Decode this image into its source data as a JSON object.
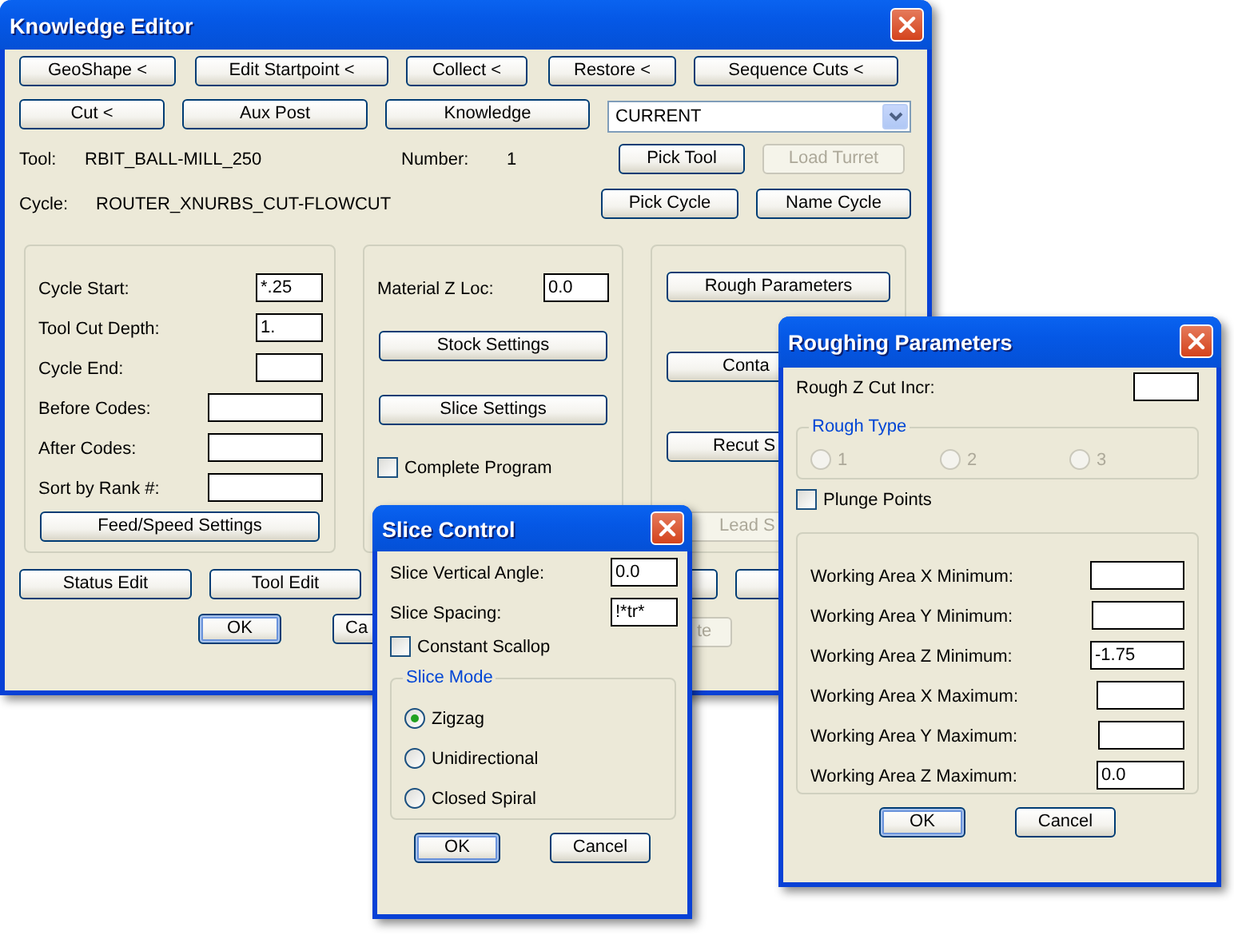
{
  "windows": [
    {
      "kind": "main",
      "title": "Knowledge Editor",
      "controls": [
        {
          "kind": "button",
          "label": "GeoShape <",
          "disabled": false,
          "default": false
        },
        {
          "kind": "button",
          "label": "Edit Startpoint <",
          "disabled": false,
          "default": false
        },
        {
          "kind": "button",
          "label": "Collect <",
          "disabled": false,
          "default": false
        },
        {
          "kind": "button",
          "label": "Restore <",
          "disabled": false,
          "default": false
        },
        {
          "kind": "button",
          "label": "Sequence Cuts <",
          "disabled": false,
          "default": false
        },
        {
          "kind": "button",
          "label": "Cut <",
          "disabled": false,
          "default": false
        },
        {
          "kind": "button",
          "label": "Aux Post",
          "disabled": false,
          "default": false
        },
        {
          "kind": "button",
          "label": "Knowledge",
          "disabled": false,
          "default": false
        },
        {
          "kind": "combo",
          "value": "CURRENT"
        },
        {
          "kind": "label",
          "text": "Tool:"
        },
        {
          "kind": "label",
          "text": "RBIT_BALL-MILL_250"
        },
        {
          "kind": "label",
          "text": "Number:"
        },
        {
          "kind": "label",
          "text": "1"
        },
        {
          "kind": "button",
          "label": "Pick Tool",
          "disabled": false,
          "default": false
        },
        {
          "kind": "button",
          "label": "Load Turret",
          "disabled": true,
          "default": false
        },
        {
          "kind": "label",
          "text": "Cycle:"
        },
        {
          "kind": "label",
          "text": "ROUTER_XNURBS_CUT-FLOWCUT"
        },
        {
          "kind": "button",
          "label": "Pick Cycle",
          "disabled": false,
          "default": false
        },
        {
          "kind": "button",
          "label": "Name Cycle",
          "disabled": false,
          "default": false
        },
        {
          "kind": "group"
        },
        {
          "kind": "label",
          "text": "Cycle Start:"
        },
        {
          "kind": "field",
          "value": "*.25"
        },
        {
          "kind": "label",
          "text": "Tool Cut Depth:"
        },
        {
          "kind": "field",
          "value": "1."
        },
        {
          "kind": "label",
          "text": "Cycle End:"
        },
        {
          "kind": "field"
        },
        {
          "kind": "label",
          "text": "Before Codes:"
        },
        {
          "kind": "field"
        },
        {
          "kind": "label",
          "text": "After Codes:"
        },
        {
          "kind": "field"
        },
        {
          "kind": "label",
          "text": "Sort by Rank #:"
        },
        {
          "kind": "field"
        },
        {
          "kind": "button",
          "label": "Feed/Speed Settings",
          "disabled": false,
          "default": false
        },
        {
          "kind": "group"
        },
        {
          "kind": "label",
          "text": "Material Z Loc:"
        },
        {
          "kind": "field",
          "value": "0.0"
        },
        {
          "kind": "button",
          "label": "Stock Settings",
          "disabled": false,
          "default": false
        },
        {
          "kind": "button",
          "label": "Slice Settings",
          "disabled": false,
          "default": false
        },
        {
          "kind": "checkbox",
          "label": "Complete Program",
          "checked": false
        },
        {
          "kind": "group"
        },
        {
          "kind": "button",
          "label": "Rough Parameters",
          "disabled": false,
          "default": false
        },
        {
          "kind": "button",
          "label": "Conta",
          "disabled": false,
          "default": false
        },
        {
          "kind": "button",
          "label": "Recut S",
          "disabled": false,
          "default": false
        },
        {
          "kind": "button",
          "label": "Lead S",
          "disabled": true,
          "default": false
        },
        {
          "kind": "button",
          "label": "Status Edit",
          "disabled": false,
          "default": false
        },
        {
          "kind": "button",
          "label": "Tool Edit",
          "disabled": false,
          "default": false
        },
        {
          "kind": "button",
          "disabled": false,
          "default": false
        },
        {
          "kind": "button",
          "disabled": false,
          "default": false
        },
        {
          "kind": "button",
          "label": "OK",
          "disabled": false,
          "default": true
        },
        {
          "kind": "button",
          "label": "Ca",
          "disabled": false,
          "default": false
        },
        {
          "kind": "button",
          "label": "te",
          "disabled": true,
          "default": false
        }
      ]
    },
    {
      "kind": "dialog",
      "title": "Slice Control",
      "controls": [
        {
          "kind": "label",
          "text": "Slice Vertical Angle:"
        },
        {
          "kind": "field",
          "value": "0.0"
        },
        {
          "kind": "label",
          "text": "Slice Spacing:"
        },
        {
          "kind": "field",
          "value": "!*tr*"
        },
        {
          "kind": "checkbox",
          "label": "Constant Scallop",
          "checked": false
        },
        {
          "kind": "group",
          "caption": "Slice Mode"
        },
        {
          "kind": "radio",
          "label": "Zigzag",
          "selected": true,
          "disabled": false
        },
        {
          "kind": "radio",
          "label": "Unidirectional",
          "selected": false,
          "disabled": false
        },
        {
          "kind": "radio",
          "label": "Closed Spiral",
          "selected": false,
          "disabled": false
        },
        {
          "kind": "button",
          "label": "OK",
          "disabled": false,
          "default": true
        },
        {
          "kind": "button",
          "label": "Cancel",
          "disabled": false,
          "default": false
        }
      ]
    },
    {
      "kind": "dialog",
      "title": "Roughing Parameters",
      "controls": [
        {
          "kind": "label",
          "text": "Rough Z Cut Incr:"
        },
        {
          "kind": "field"
        },
        {
          "kind": "group",
          "caption": "Rough Type"
        },
        {
          "kind": "radio",
          "label": "1",
          "selected": false,
          "disabled": true
        },
        {
          "kind": "radio",
          "label": "2",
          "selected": false,
          "disabled": true
        },
        {
          "kind": "radio",
          "label": "3",
          "selected": false,
          "disabled": true
        },
        {
          "kind": "checkbox",
          "label": "Plunge Points",
          "checked": false
        },
        {
          "kind": "group"
        },
        {
          "kind": "label",
          "text": "Working Area X Minimum:"
        },
        {
          "kind": "field"
        },
        {
          "kind": "label",
          "text": "Working Area Y Minimum:"
        },
        {
          "kind": "field"
        },
        {
          "kind": "label",
          "text": "Working Area Z Minimum:"
        },
        {
          "kind": "field",
          "value": "-1.75"
        },
        {
          "kind": "label",
          "text": "Working Area X Maximum:"
        },
        {
          "kind": "field"
        },
        {
          "kind": "label",
          "text": "Working Area Y Maximum:"
        },
        {
          "kind": "field"
        },
        {
          "kind": "label",
          "text": "Working Area Z Maximum:"
        },
        {
          "kind": "field",
          "value": "0.0"
        },
        {
          "kind": "button",
          "label": "OK",
          "disabled": false,
          "default": true
        },
        {
          "kind": "button",
          "label": "Cancel",
          "disabled": false,
          "default": false
        }
      ]
    }
  ]
}
